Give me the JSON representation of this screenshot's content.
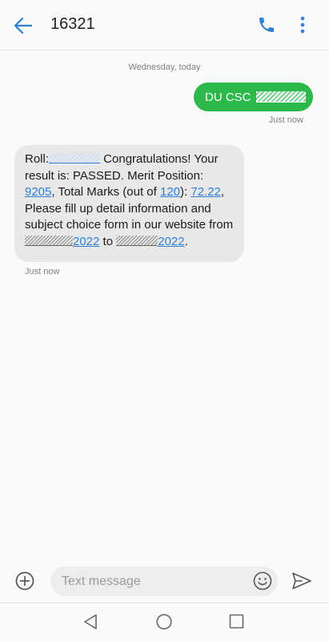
{
  "header": {
    "title": "16321",
    "back_icon": "arrow-left-icon",
    "call_icon": "phone-icon",
    "more_icon": "more-vertical-icon",
    "accent_color": "#2f7fd4"
  },
  "conversation": {
    "date_separator": "Wednesday, today",
    "sent": {
      "text": "DU CSC",
      "time": "Just now",
      "bubble_color": "#2db84c"
    },
    "received": {
      "roll_label": "Roll:",
      "text_1": " Congratulations! Your result is: PASSED. Merit Position: ",
      "merit_position": "9205",
      "text_2": ", Total Marks (out of ",
      "out_of": "120",
      "text_3": "): ",
      "total_marks": "72.22",
      "text_4": ", Please fill up detail information and subject choice form in our website from ",
      "year_1": "2022",
      "text_5": " to ",
      "year_2": "2022",
      "text_6": ".",
      "time": "Just now",
      "bubble_color": "#e8e8e8"
    }
  },
  "composer": {
    "placeholder": "Text message",
    "add_icon": "plus-circle-icon",
    "emoji_icon": "emoji-icon",
    "send_icon": "send-icon"
  },
  "navbar": {
    "back_icon": "nav-back-icon",
    "home_icon": "nav-home-icon",
    "recents_icon": "nav-recents-icon"
  }
}
